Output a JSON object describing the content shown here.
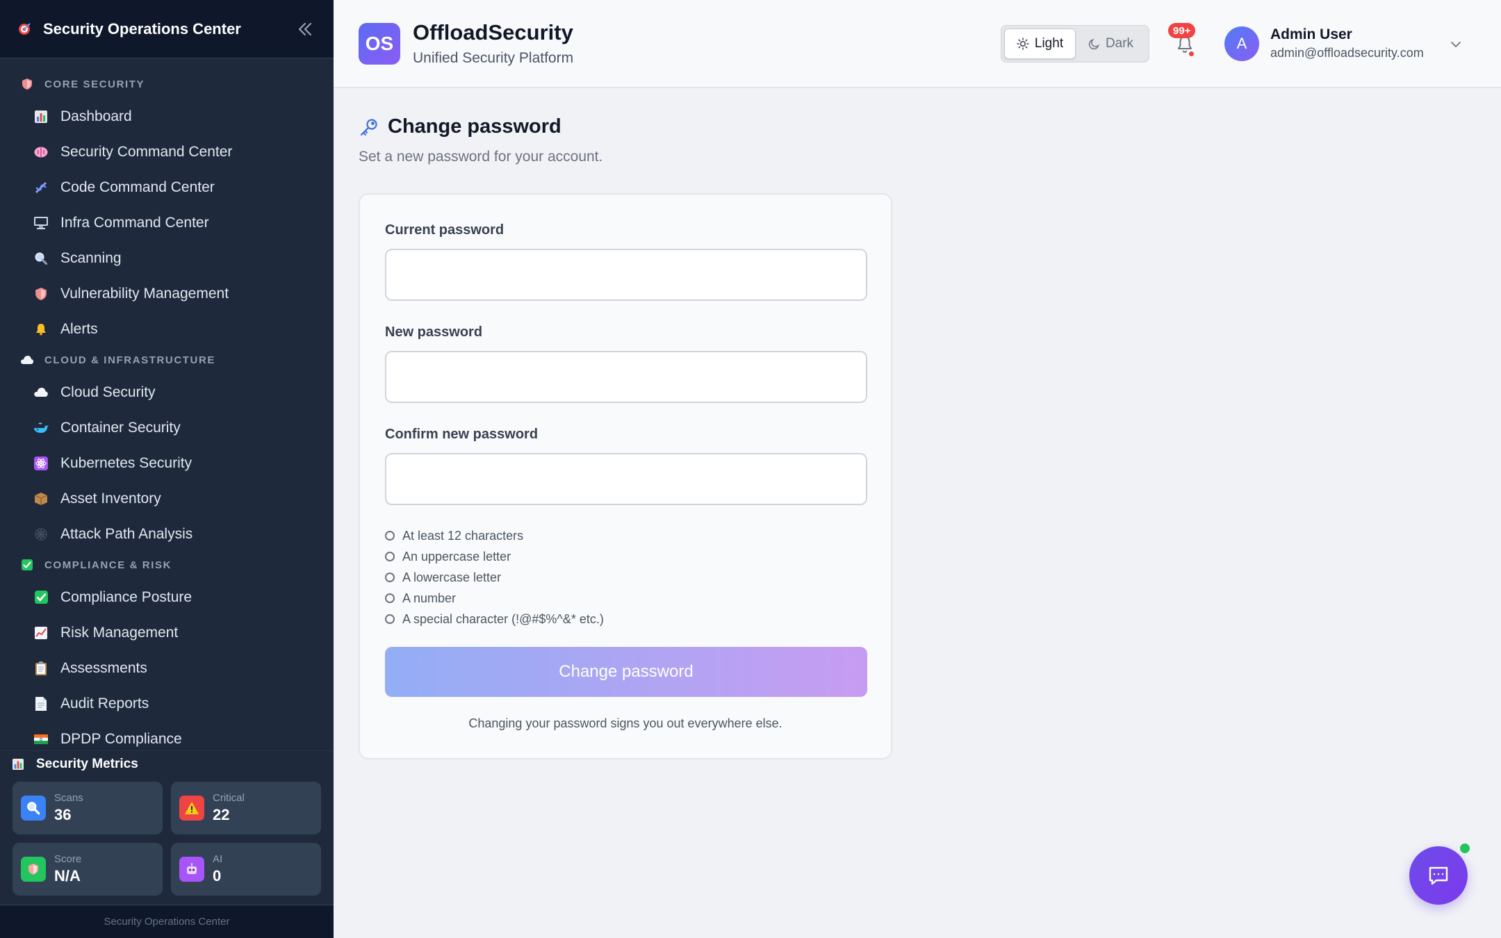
{
  "sidebar": {
    "title": "Security Operations Center",
    "sections": [
      {
        "label": "CORE SECURITY",
        "icon": "shield-icon",
        "items": [
          {
            "label": "Dashboard",
            "icon": "bar-chart-icon"
          },
          {
            "label": "Security Command Center",
            "icon": "brain-icon"
          },
          {
            "label": "Code Command Center",
            "icon": "dna-icon"
          },
          {
            "label": "Infra Command Center",
            "icon": "monitor-icon"
          },
          {
            "label": "Scanning",
            "icon": "magnifier-icon"
          },
          {
            "label": "Vulnerability Management",
            "icon": "shield-icon"
          },
          {
            "label": "Alerts",
            "icon": "bell-icon"
          }
        ]
      },
      {
        "label": "CLOUD & INFRASTRUCTURE",
        "icon": "cloud-icon",
        "items": [
          {
            "label": "Cloud Security",
            "icon": "cloud-icon"
          },
          {
            "label": "Container Security",
            "icon": "whale-icon"
          },
          {
            "label": "Kubernetes Security",
            "icon": "atom-icon"
          },
          {
            "label": "Asset Inventory",
            "icon": "package-icon"
          },
          {
            "label": "Attack Path Analysis",
            "icon": "web-icon"
          }
        ]
      },
      {
        "label": "COMPLIANCE & RISK",
        "icon": "check-box-icon",
        "items": [
          {
            "label": "Compliance Posture",
            "icon": "check-box-icon"
          },
          {
            "label": "Risk Management",
            "icon": "trend-chart-icon"
          },
          {
            "label": "Assessments",
            "icon": "clipboard-icon"
          },
          {
            "label": "Audit Reports",
            "icon": "document-icon"
          },
          {
            "label": "DPDP Compliance",
            "icon": "india-flag-icon"
          }
        ]
      }
    ],
    "metrics": {
      "title": "Security Metrics",
      "cards": [
        {
          "label": "Scans",
          "value": "36",
          "icon": "magnifier-icon",
          "color": "#3b82f6"
        },
        {
          "label": "Critical",
          "value": "22",
          "icon": "warning-icon",
          "color": "#ef4444"
        },
        {
          "label": "Score",
          "value": "N/A",
          "icon": "shield-icon",
          "color": "#22c55e"
        },
        {
          "label": "AI",
          "value": "0",
          "icon": "robot-icon",
          "color": "#a855f7"
        }
      ]
    },
    "footer": "Security Operations Center"
  },
  "header": {
    "logo_text": "OS",
    "brand_name": "OffloadSecurity",
    "brand_sub": "Unified Security Platform",
    "theme": {
      "light": "Light",
      "dark": "Dark",
      "active": "light"
    },
    "notifications_badge": "99+",
    "user": {
      "initial": "A",
      "name": "Admin User",
      "email": "admin@offloadsecurity.com"
    }
  },
  "main": {
    "title": "Change password",
    "subtitle": "Set a new password for your account.",
    "fields": {
      "current_label": "Current password",
      "current_value": "",
      "new_label": "New password",
      "new_value": "",
      "confirm_label": "Confirm new password",
      "confirm_value": ""
    },
    "requirements": [
      "At least 12 characters",
      "An uppercase letter",
      "A lowercase letter",
      "A number",
      "A special character (!@#$%^&* etc.)"
    ],
    "submit_label": "Change password",
    "note": "Changing your password signs you out everywhere else."
  },
  "colors": {
    "sidebar_bg": "#1e293b",
    "sidebar_header_bg": "#0f172a",
    "accent": "#6366f1",
    "button_gradient_start": "#93aef5",
    "button_gradient_end": "#c79cf2",
    "badge_red": "#ef4444",
    "online_green": "#22c55e"
  }
}
